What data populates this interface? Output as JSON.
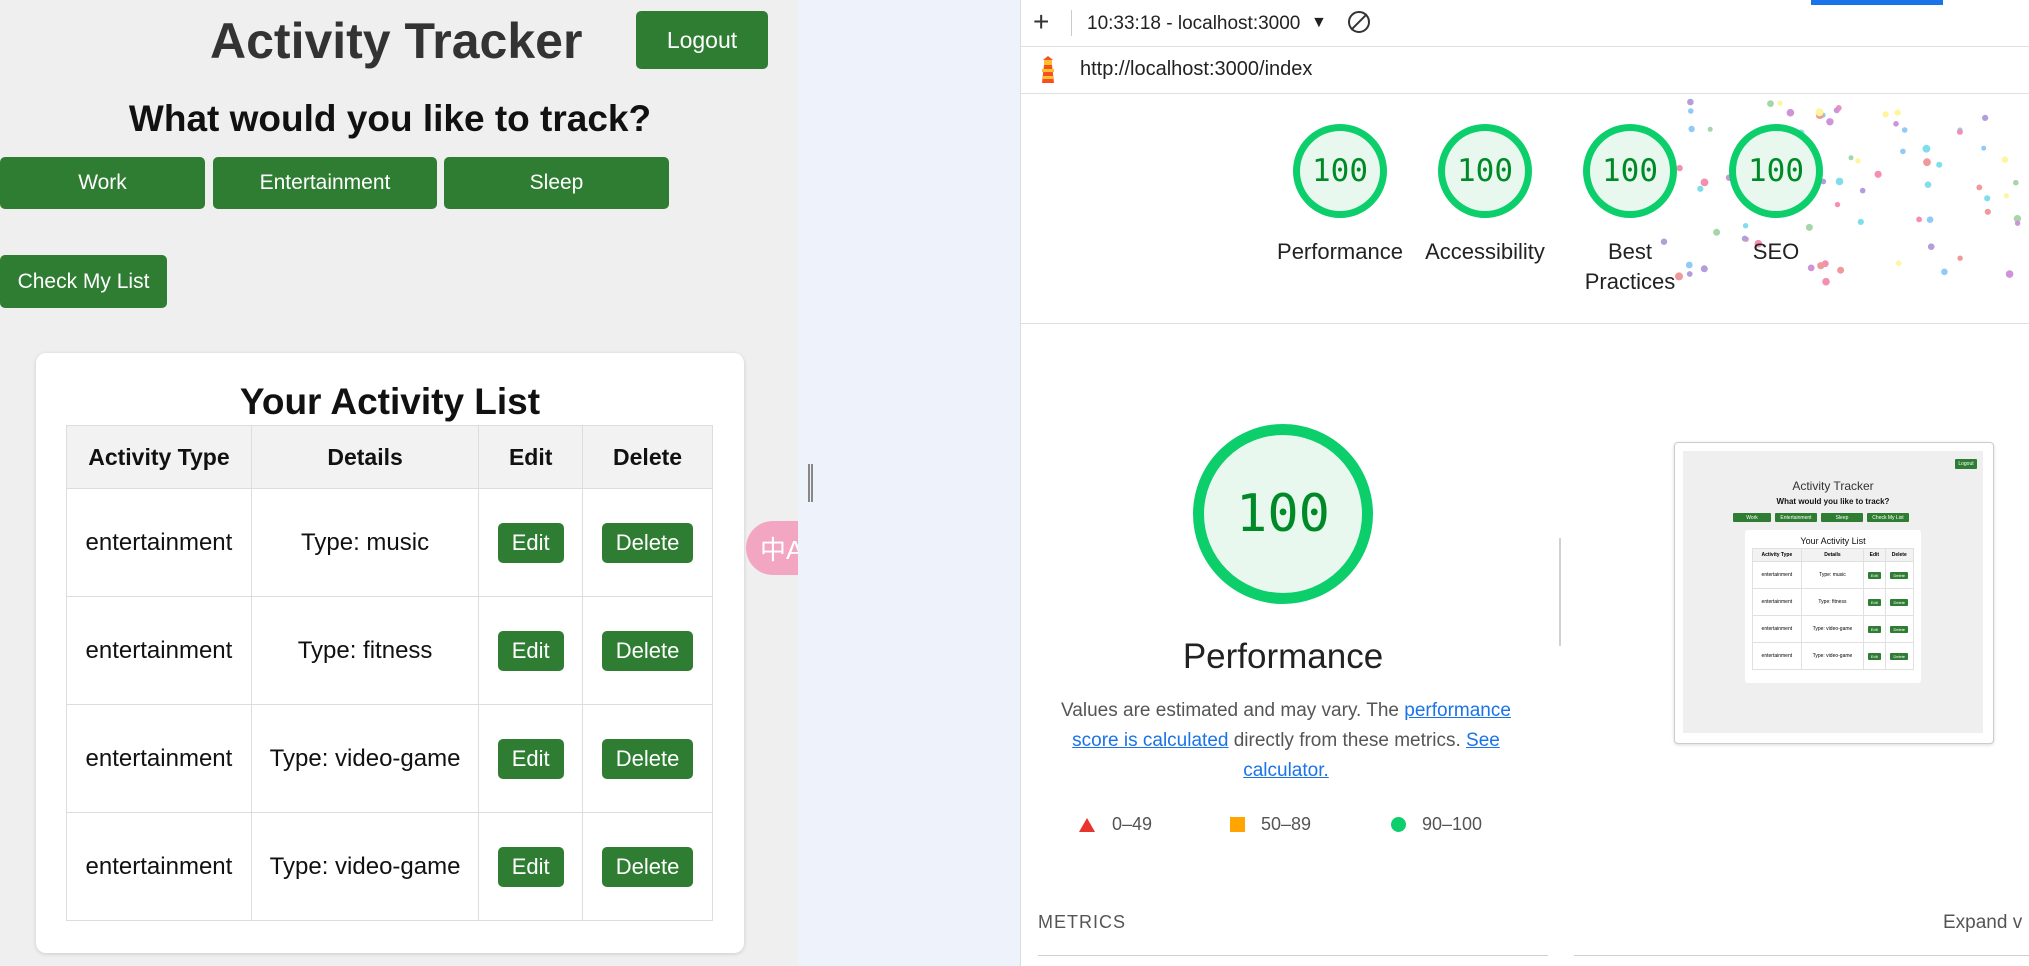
{
  "app": {
    "title": "Activity Tracker",
    "logout_label": "Logout",
    "question": "What would you like to track?",
    "categories": [
      "Work",
      "Entertainment",
      "Sleep"
    ],
    "check_list_label": "Check My List",
    "list_title": "Your Activity List",
    "table_headers": [
      "Activity Type",
      "Details",
      "Edit",
      "Delete"
    ],
    "rows": [
      {
        "type": "entertainment",
        "details": "Type: music",
        "edit": "Edit",
        "delete": "Delete"
      },
      {
        "type": "entertainment",
        "details": "Type: fitness",
        "edit": "Edit",
        "delete": "Delete"
      },
      {
        "type": "entertainment",
        "details": "Type: video-game",
        "edit": "Edit",
        "delete": "Delete"
      },
      {
        "type": "entertainment",
        "details": "Type: video-game",
        "edit": "Edit",
        "delete": "Delete"
      }
    ],
    "translate_icon": "中A"
  },
  "lighthouse": {
    "time_host": "10:33:18 - localhost:3000",
    "url": "http://localhost:3000/index",
    "scores": [
      {
        "value": "100",
        "label": "Performance"
      },
      {
        "value": "100",
        "label": "Accessibility"
      },
      {
        "value": "100",
        "label": "Best Practices"
      },
      {
        "value": "100",
        "label": "SEO"
      }
    ],
    "performance": {
      "score": "100",
      "title": "Performance",
      "desc_prefix": "Values are estimated and may vary. The ",
      "desc_link": "performance score is calculated",
      "desc_middle": " directly from these metrics. ",
      "desc_link2": "See calculator."
    },
    "legend": [
      "0–49",
      "50–89",
      "90–100"
    ],
    "metrics_label": "METRICS",
    "expand_label": "Expand v",
    "colors": {
      "pass": "#0cce6b",
      "average": "#ffa400",
      "fail": "#e8342c",
      "accent": "#1a73e8",
      "app_green": "#2e7d32"
    },
    "thumbnail": {
      "logout": "Logout",
      "title": "Activity Tracker",
      "question": "What would you like to track?",
      "buttons": [
        "Work",
        "Entertainment",
        "Sleep",
        "Check My List"
      ],
      "list_title": "Your Activity List",
      "headers": [
        "Activity Type",
        "Details",
        "Edit",
        "Delete"
      ],
      "rows": [
        {
          "type": "entertainment",
          "details": "Type: music"
        },
        {
          "type": "entertainment",
          "details": "Type: fitness"
        },
        {
          "type": "entertainment",
          "details": "Type: video-game"
        },
        {
          "type": "entertainment",
          "details": "Type: video-game"
        }
      ],
      "edit": "Edit",
      "delete": "Delete"
    }
  }
}
